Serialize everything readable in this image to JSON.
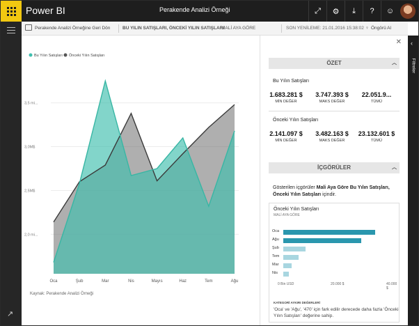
{
  "topbar": {
    "app_name": "Power BI",
    "report_title": "Perakende Analizi Örneği",
    "icons": [
      "expand-icon",
      "gear-icon",
      "download-icon",
      "help-icon",
      "smiley-icon"
    ]
  },
  "actionbar": {
    "back_label": "Perakende Analizi Örneğine Geri Dön",
    "measures": "BU YILIN SATIŞLARI, ÖNCEKİ YILIN SATIŞLARI",
    "by_label": "MALİ AYA GÖRE",
    "refresh": "SON YENİLEME: 21.01.2016 15:38:02",
    "qa": "Öngörü Al"
  },
  "filters": {
    "label": "Filtreler"
  },
  "source": "Kaynak: Perakende Analizi Örneği",
  "summary": {
    "header": "ÖZET",
    "this_year": {
      "title": "Bu Yılın Satışları",
      "min": "1.683.281 $",
      "min_label": "MİN DEĞER",
      "max": "3.747.393 $",
      "max_label": "MAKS DEĞER",
      "total": "22.051.9...",
      "total_label": "TÜMÜ"
    },
    "last_year": {
      "title": "Önceki Yılın Satışları",
      "min": "2.141.097 $",
      "min_label": "MİN DEĞER",
      "max": "3.482.163 $",
      "max_label": "MAKS DEĞER",
      "total": "23.132.601 $",
      "total_label": "TÜMÜ"
    }
  },
  "insights": {
    "header": "İÇGÖRÜLER",
    "text_prefix": "Gösterilen içgörüler ",
    "text_bold": "Mali Aya Göre Bu Yılın Satışları, Önceki Yılın Satışları",
    "text_suffix": " içindir.",
    "card": {
      "title": "Önceki Yılın Satışları",
      "subtitle": "MALİ AYA GÖRE",
      "categories": [
        "Oca",
        "Ağu",
        "Şub",
        "Tem",
        "Mar",
        "Nis"
      ],
      "values": [
        33000,
        28000,
        8000,
        5500,
        3000,
        2000
      ],
      "bar_colors": [
        "#2a97ae",
        "#2a97ae",
        "#a8d6e0",
        "#a8d6e0",
        "#a8d6e0",
        "#a8d6e0"
      ],
      "xticks": [
        "0 Bin USD",
        "20.000 $",
        "40.000 $"
      ],
      "xmax": 40000,
      "caption": "KATEGORİ AYKIRI DEĞERLERİ",
      "desc": "'Oca' ve 'Ağu', '470' için fark edilir derecede daha fazla 'Önceki Yılın Satışları' değerine sahip."
    }
  },
  "chart_data": {
    "type": "area",
    "categories": [
      "Oca",
      "Şub",
      "Mar",
      "Nis",
      "Mayıs",
      "Haz",
      "Tem",
      "Ağu"
    ],
    "series": [
      {
        "name": "Bu Yılın Satışları",
        "color": "#3fbfae",
        "values": [
          1.68,
          2.58,
          3.75,
          2.67,
          2.75,
          3.1,
          2.32,
          3.18
        ]
      },
      {
        "name": "Önceki Yılın Satışları",
        "color": "#555555",
        "values": [
          2.14,
          2.6,
          2.79,
          3.38,
          2.61,
          2.92,
          3.22,
          3.48
        ]
      }
    ],
    "yticks": [
      2.0,
      2.5,
      3.0,
      3.5
    ],
    "ytick_labels": [
      "2,0 mi...",
      "2,5M$",
      "3,0M$",
      "3,5 mi..."
    ],
    "ylim": [
      1.55,
      3.95
    ],
    "legend_position": "top-left",
    "grid": true
  }
}
